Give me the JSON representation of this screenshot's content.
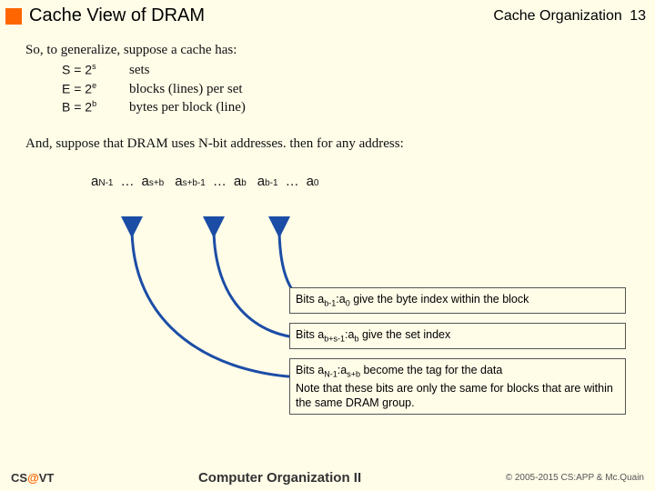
{
  "header": {
    "title": "Cache View of DRAM",
    "section": "Cache Organization",
    "page": "13"
  },
  "intro": "So, to generalize, suppose a cache has:",
  "params": [
    {
      "lhs_prefix": "S = 2",
      "lhs_sup": "s",
      "desc": "sets"
    },
    {
      "lhs_prefix": "E = 2",
      "lhs_sup": "e",
      "desc": "blocks (lines) per set"
    },
    {
      "lhs_prefix": "B = 2",
      "lhs_sup": "b",
      "desc": "bytes per block (line)"
    }
  ],
  "and_line": "And, suppose that DRAM uses N-bit addresses.  then for any address:",
  "bits": {
    "g1": {
      "a": "a",
      "sub": "N-1"
    },
    "d1": "…",
    "g2": {
      "a": "a",
      "sub": "s+b"
    },
    "g3": {
      "a": "a",
      "sub": "s+b-1"
    },
    "d2": "…",
    "g4": {
      "a": "a",
      "sub": "b"
    },
    "g5": {
      "a": "a",
      "sub": "b-1"
    },
    "d3": "…",
    "g6": {
      "a": "a",
      "sub": "0"
    }
  },
  "boxes": {
    "b1_pre": "Bits a",
    "b1_sub1": "b-1",
    "b1_mid": ":a",
    "b1_sub2": "0",
    "b1_post": " give the byte index within the block",
    "b2_pre": "Bits a",
    "b2_sub1": "b+s-1",
    "b2_mid": ":a",
    "b2_sub2": "b",
    "b2_post": " give the set index",
    "b3_pre": "Bits a",
    "b3_sub1": "N-1",
    "b3_mid": ":a",
    "b3_sub2": "s+b",
    "b3_post": " become the tag for the data",
    "b3_note": "Note that these bits are only the same for blocks that are within the same DRAM group."
  },
  "footer": {
    "left_a": "CS",
    "left_at": "@",
    "left_b": "VT",
    "center": "Computer Organization II",
    "right": "© 2005-2015 CS:APP & Mc.Quain"
  }
}
